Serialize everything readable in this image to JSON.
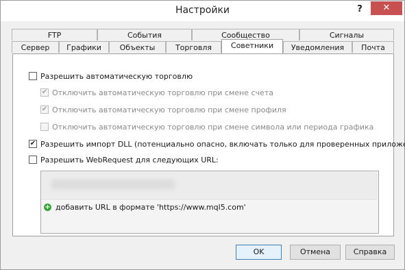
{
  "window": {
    "title": "Настройки",
    "help_glyph": "?",
    "close_glyph": "✕"
  },
  "tabs_back": [
    "FTP",
    "События",
    "Сообщество",
    "Сигналы"
  ],
  "tabs_front": [
    "Сервер",
    "Графики",
    "Объекты",
    "Торговля",
    "Советники",
    "Уведомления",
    "Почта"
  ],
  "active_tab": "Советники",
  "options": {
    "allow_auto_trading": {
      "label": "Разрешить автоматическую торговлю",
      "checked": false
    },
    "disable_on_account_change": {
      "label": "Отключить автоматическую торговлю при смене счета",
      "checked": true,
      "disabled": true
    },
    "disable_on_profile_change": {
      "label": "Отключить автоматическую торговлю при смене профиля",
      "checked": true,
      "disabled": true
    },
    "disable_on_symbol_change": {
      "label": "Отключить автоматическую торговлю при смене символа или периода графика",
      "checked": false,
      "disabled": true
    },
    "allow_dll_import": {
      "label": "Разрешить импорт DLL (потенциально опасно, включать только для проверенных приложений)",
      "checked": true
    },
    "allow_webrequest": {
      "label": "Разрешить WebRequest для следующих URL:",
      "checked": false
    }
  },
  "url_list": {
    "add_hint": "добавить URL в формате 'https://www.mql5.com'"
  },
  "buttons": {
    "ok": "OK",
    "cancel": "Отмена",
    "help": "Справка"
  }
}
